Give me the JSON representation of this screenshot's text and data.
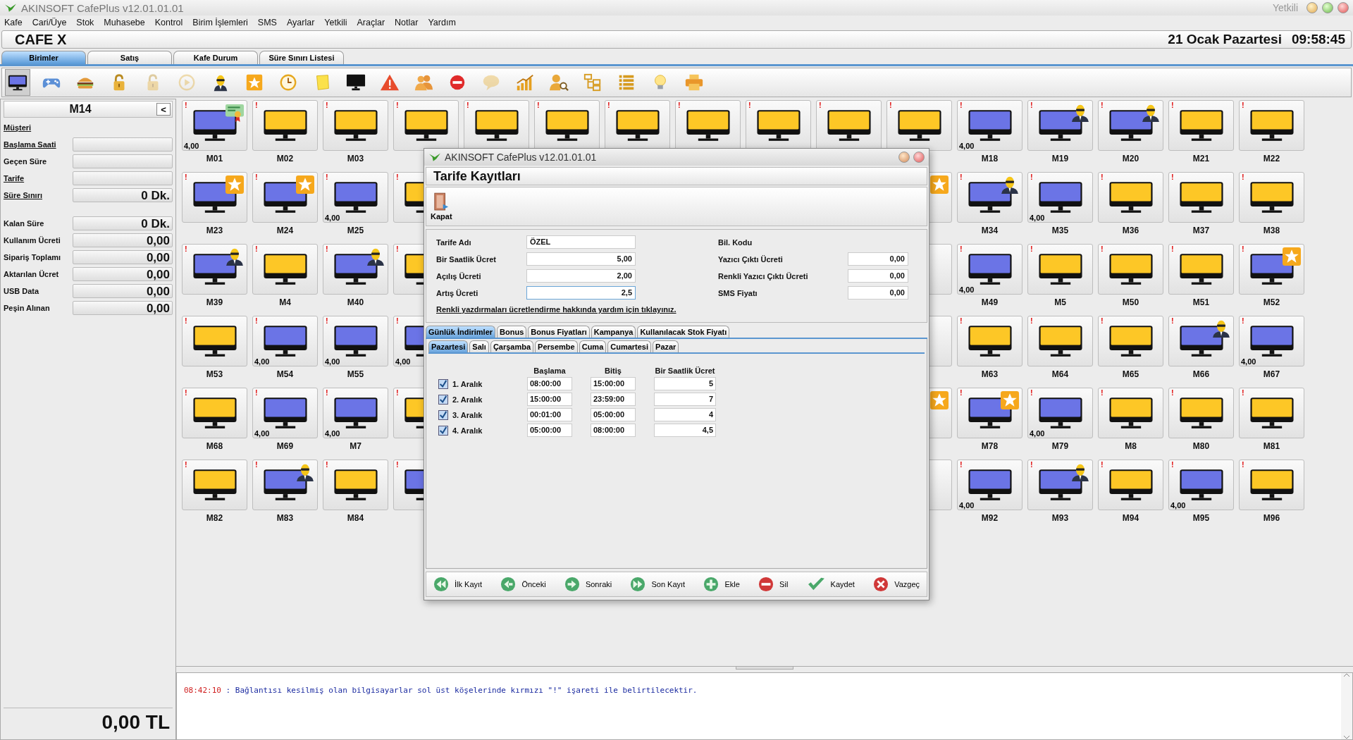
{
  "window": {
    "title": "AKINSOFT CafePlus v12.01.01.01",
    "user": "Yetkili"
  },
  "menu": [
    "Kafe",
    "Cari/Üye",
    "Stok",
    "Muhasebe",
    "Kontrol",
    "Birim İşlemleri",
    "SMS",
    "Ayarlar",
    "Yetkili",
    "Araçlar",
    "Notlar",
    "Yardım"
  ],
  "header": {
    "cafe_name": "CAFE X",
    "date": "21 Ocak Pazartesi",
    "time": "09:58:45"
  },
  "tabs": [
    {
      "label": "Birimler",
      "selected": true
    },
    {
      "label": "Satış",
      "selected": false
    },
    {
      "label": "Kafe Durum",
      "selected": false
    },
    {
      "label": "Süre Sınırı Listesi",
      "selected": false
    }
  ],
  "toolbar": [
    {
      "kind": "monitor",
      "selected": true,
      "disabled": false
    },
    {
      "kind": "gamepad",
      "selected": false,
      "disabled": false
    },
    {
      "kind": "burger",
      "selected": false,
      "disabled": false
    },
    {
      "kind": "padlock",
      "selected": false,
      "disabled": false
    },
    {
      "kind": "padlock",
      "selected": false,
      "disabled": true
    },
    {
      "kind": "play",
      "selected": false,
      "disabled": true
    },
    {
      "kind": "agent",
      "selected": false,
      "disabled": false
    },
    {
      "kind": "star",
      "selected": false,
      "disabled": false
    },
    {
      "kind": "clock",
      "selected": false,
      "disabled": false
    },
    {
      "kind": "note",
      "selected": false,
      "disabled": false
    },
    {
      "kind": "screen",
      "selected": false,
      "disabled": false
    },
    {
      "kind": "warning",
      "selected": false,
      "disabled": false
    },
    {
      "kind": "users",
      "selected": false,
      "disabled": false
    },
    {
      "kind": "stop",
      "selected": false,
      "disabled": false
    },
    {
      "kind": "chat",
      "selected": false,
      "disabled": true
    },
    {
      "kind": "chart",
      "selected": false,
      "disabled": false
    },
    {
      "kind": "usersearch",
      "selected": false,
      "disabled": false
    },
    {
      "kind": "hierarchy",
      "selected": false,
      "disabled": false
    },
    {
      "kind": "list",
      "selected": false,
      "disabled": false
    },
    {
      "kind": "bulb",
      "selected": false,
      "disabled": false
    },
    {
      "kind": "printer",
      "selected": false,
      "disabled": false
    }
  ],
  "side_panel": {
    "unit": "M14",
    "collapse_button": "<",
    "fields": [
      {
        "label": "Müşteri",
        "link": true,
        "kind": "label"
      },
      {
        "label": "Başlama Saati",
        "link": true,
        "kind": "field"
      },
      {
        "label": "Geçen Süre",
        "link": false,
        "kind": "field"
      },
      {
        "label": "Tarife",
        "link": true,
        "kind": "field"
      },
      {
        "label": "Süre Sınırı",
        "link": true,
        "kind": "field",
        "value": "0 Dk."
      },
      {
        "label": "Kalan Süre",
        "link": false,
        "kind": "field",
        "value": "0 Dk."
      },
      {
        "label": "Kullanım Ücreti",
        "link": false,
        "kind": "field",
        "value": "0,00"
      },
      {
        "label": "Sipariş Toplamı",
        "link": false,
        "kind": "field",
        "value": "0,00"
      },
      {
        "label": "Aktarılan Ücret",
        "link": false,
        "kind": "field",
        "value": "0,00"
      },
      {
        "label": "USB Data",
        "link": false,
        "kind": "field",
        "value": "0,00"
      },
      {
        "label": "Peşin Alınan",
        "link": false,
        "kind": "field",
        "value": "0,00"
      }
    ],
    "total": "0,00 TL"
  },
  "units": [
    {
      "kind": "certificate",
      "label": "M01",
      "color": "#6b74e6",
      "flag": "!",
      "amount": "4,00"
    },
    {
      "kind": "plain",
      "label": "M02",
      "color": "#fdc726",
      "flag": "!"
    },
    {
      "kind": "plain",
      "label": "M03",
      "color": "#fdc726",
      "flag": "!"
    },
    {
      "kind": "plain",
      "color": "#fdc726",
      "flag": "!"
    },
    {
      "kind": "plain",
      "color": "#fdc726",
      "flag": "!"
    },
    {
      "kind": "plain",
      "color": "#fdc726",
      "flag": "!"
    },
    {
      "kind": "plain",
      "color": "#fdc726",
      "flag": "!"
    },
    {
      "kind": "plain",
      "color": "#fdc726",
      "flag": "!"
    },
    {
      "kind": "plain",
      "color": "#fdc726",
      "flag": "!"
    },
    {
      "kind": "plain",
      "color": "#fdc726",
      "flag": "!"
    },
    {
      "kind": "plain",
      "color": "#fdc726",
      "flag": "!"
    },
    {
      "kind": "plain",
      "label": "M18",
      "color": "#6b74e6",
      "flag": "!",
      "amount": "4,00"
    },
    {
      "kind": "agent",
      "label": "M19",
      "color": "#6b74e6",
      "flag": "!"
    },
    {
      "kind": "agent",
      "label": "M20",
      "color": "#6b74e6",
      "flag": "!"
    },
    {
      "kind": "plain",
      "label": "M21",
      "color": "#fdc726",
      "flag": "!"
    },
    {
      "kind": "plain",
      "label": "M22",
      "color": "#fdc726",
      "flag": "!"
    },
    {
      "kind": "star",
      "label": "M23",
      "color": "#6b74e6",
      "flag": "!"
    },
    {
      "kind": "star",
      "label": "M24",
      "color": "#6b74e6",
      "flag": "!"
    },
    {
      "kind": "plain",
      "label": "M25",
      "color": "#6b74e6",
      "flag": "!",
      "amount": "4,00"
    },
    {
      "kind": "cut",
      "color": "#fdc726",
      "flag": "!"
    },
    {
      "kind": "covered"
    },
    {
      "kind": "covered"
    },
    {
      "kind": "covered"
    },
    {
      "kind": "covered"
    },
    {
      "kind": "covered"
    },
    {
      "kind": "covered"
    },
    {
      "kind": "star"
    },
    {
      "kind": "agent",
      "label": "M34",
      "color": "#6b74e6",
      "flag": "!"
    },
    {
      "kind": "plain",
      "label": "M35",
      "color": "#6b74e6",
      "flag": "!",
      "amount": "4,00"
    },
    {
      "kind": "plain",
      "label": "M36",
      "color": "#fdc726",
      "flag": "!"
    },
    {
      "kind": "plain",
      "label": "M37",
      "color": "#fdc726",
      "flag": "!"
    },
    {
      "kind": "plain",
      "label": "M38",
      "color": "#fdc726",
      "flag": "!"
    },
    {
      "kind": "agent",
      "label": "M39",
      "color": "#6b74e6",
      "flag": "!"
    },
    {
      "kind": "plain",
      "label": "M4",
      "color": "#fdc726",
      "flag": "!"
    },
    {
      "kind": "agent",
      "label": "M40",
      "color": "#6b74e6",
      "flag": "!"
    },
    {
      "kind": "cut",
      "color": "#fdc726",
      "flag": "!"
    },
    {
      "kind": "covered"
    },
    {
      "kind": "covered"
    },
    {
      "kind": "covered"
    },
    {
      "kind": "covered"
    },
    {
      "kind": "covered"
    },
    {
      "kind": "covered"
    },
    {
      "kind": "plain"
    },
    {
      "kind": "plain",
      "label": "M49",
      "color": "#6b74e6",
      "flag": "!",
      "amount": "4,00"
    },
    {
      "kind": "plain",
      "label": "M5",
      "color": "#fdc726",
      "flag": "!"
    },
    {
      "kind": "plain",
      "label": "M50",
      "color": "#fdc726",
      "flag": "!"
    },
    {
      "kind": "plain",
      "label": "M51",
      "color": "#fdc726",
      "flag": "!"
    },
    {
      "kind": "star",
      "label": "M52",
      "color": "#6b74e6",
      "flag": "!"
    },
    {
      "kind": "plain",
      "label": "M53",
      "color": "#fdc726",
      "flag": "!"
    },
    {
      "kind": "plain",
      "label": "M54",
      "color": "#6b74e6",
      "flag": "!",
      "amount": "4,00"
    },
    {
      "kind": "plain",
      "label": "M55",
      "color": "#6b74e6",
      "flag": "!",
      "amount": "4,00"
    },
    {
      "kind": "cut",
      "color": "#6b74e6",
      "flag": "!",
      "amount": "4,00"
    },
    {
      "kind": "covered"
    },
    {
      "kind": "covered"
    },
    {
      "kind": "covered"
    },
    {
      "kind": "covered"
    },
    {
      "kind": "covered"
    },
    {
      "kind": "covered"
    },
    {
      "kind": "plain"
    },
    {
      "kind": "plain",
      "label": "M63",
      "color": "#fdc726",
      "flag": "!"
    },
    {
      "kind": "plain",
      "label": "M64",
      "color": "#fdc726",
      "flag": "!"
    },
    {
      "kind": "plain",
      "label": "M65",
      "color": "#fdc726",
      "flag": "!"
    },
    {
      "kind": "agent",
      "label": "M66",
      "color": "#6b74e6",
      "flag": "!"
    },
    {
      "kind": "plain",
      "label": "M67",
      "color": "#6b74e6",
      "flag": "!",
      "amount": "4,00"
    },
    {
      "kind": "plain",
      "label": "M68",
      "color": "#fdc726",
      "flag": "!"
    },
    {
      "kind": "plain",
      "label": "M69",
      "color": "#6b74e6",
      "flag": "!",
      "amount": "4,00"
    },
    {
      "kind": "plain",
      "label": "M7",
      "color": "#6b74e6",
      "flag": "!",
      "amount": "4,00"
    },
    {
      "kind": "cut",
      "color": "#fdc726",
      "flag": "!"
    },
    {
      "kind": "covered"
    },
    {
      "kind": "covered"
    },
    {
      "kind": "covered"
    },
    {
      "kind": "covered"
    },
    {
      "kind": "covered"
    },
    {
      "kind": "covered"
    },
    {
      "kind": "star"
    },
    {
      "kind": "star",
      "label": "M78",
      "color": "#6b74e6",
      "flag": "!"
    },
    {
      "kind": "plain",
      "label": "M79",
      "color": "#6b74e6",
      "flag": "!",
      "amount": "4,00"
    },
    {
      "kind": "plain",
      "label": "M8",
      "color": "#fdc726",
      "flag": "!"
    },
    {
      "kind": "plain",
      "label": "M80",
      "color": "#fdc726",
      "flag": "!"
    },
    {
      "kind": "plain",
      "label": "M81",
      "color": "#fdc726",
      "flag": "!"
    },
    {
      "kind": "plain",
      "label": "M82",
      "color": "#fdc726",
      "flag": "!"
    },
    {
      "kind": "agent",
      "label": "M83",
      "color": "#6b74e6",
      "flag": "!"
    },
    {
      "kind": "plain",
      "label": "M84",
      "color": "#fdc726",
      "flag": "!"
    },
    {
      "kind": "cut",
      "color": "#6b74e6",
      "flag": "!"
    },
    {
      "kind": "covered"
    },
    {
      "kind": "covered"
    },
    {
      "kind": "covered"
    },
    {
      "kind": "covered"
    },
    {
      "kind": "covered"
    },
    {
      "kind": "covered"
    },
    {
      "kind": "plain"
    },
    {
      "kind": "plain",
      "label": "M92",
      "color": "#6b74e6",
      "flag": "!",
      "amount": "4,00"
    },
    {
      "kind": "agent",
      "label": "M93",
      "color": "#6b74e6",
      "flag": "!"
    },
    {
      "kind": "plain",
      "label": "M94",
      "color": "#fdc726",
      "flag": "!"
    },
    {
      "kind": "plain",
      "label": "M95",
      "color": "#6b74e6",
      "flag": "!",
      "amount": "4,00"
    },
    {
      "kind": "plain",
      "label": "M96",
      "color": "#fdc726",
      "flag": "!"
    }
  ],
  "log": [
    {
      "time": "08:42:10",
      "message": ": Bağlantısı kesilmiş olan bilgisayarlar sol üst köşelerinde kırmızı \"!\" işareti ile belirtilecektir."
    }
  ],
  "dialog": {
    "title": "AKINSOFT CafePlus v12.01.01.01",
    "heading": "Tarife Kayıtları",
    "close_button": "Kapat",
    "left_fields": [
      {
        "label": "Tarife Adı",
        "value": "ÖZEL",
        "kind": "text",
        "focused": false
      },
      {
        "label": "Bir Saatlik Ücret",
        "value": "5,00",
        "kind": "number",
        "focused": false
      },
      {
        "label": "Açılış Ücreti",
        "value": "2,00",
        "kind": "number",
        "focused": false
      },
      {
        "label": "Artış Ücreti",
        "value": "2,5",
        "kind": "number",
        "focused": true
      }
    ],
    "right_fields": [
      {
        "label": "Bil. Kodu",
        "kind": "label"
      },
      {
        "label": "Yazıcı Çıktı Ücreti",
        "value": "0,00",
        "kind": "field"
      },
      {
        "label": "Renkli Yazıcı Çıktı Ücreti",
        "value": "0,00",
        "kind": "field"
      },
      {
        "label": "SMS Fiyatı",
        "value": "0,00",
        "kind": "field"
      }
    ],
    "help_link": "Renkli yazdırmaları ücretlendirme hakkında yardım için tıklayınız.",
    "tabs": [
      {
        "label": "Günlük İndirimler",
        "selected": true
      },
      {
        "label": "Bonus",
        "selected": false
      },
      {
        "label": "Bonus Fiyatları",
        "selected": false
      },
      {
        "label": "Kampanya",
        "selected": false
      },
      {
        "label": "Kullanılacak Stok Fiyatı",
        "selected": false
      }
    ],
    "day_tabs": [
      {
        "label": "Pazartesi",
        "selected": true
      },
      {
        "label": "Salı",
        "selected": false
      },
      {
        "label": "Çarşamba",
        "selected": false
      },
      {
        "label": "Persembe",
        "selected": false
      },
      {
        "label": "Cuma",
        "selected": false
      },
      {
        "label": "Cumartesi",
        "selected": false
      },
      {
        "label": "Pazar",
        "selected": false
      }
    ],
    "columns": [
      "Başlama",
      "Bitiş",
      "Bir Saatlik Ücret"
    ],
    "ranges": [
      {
        "label": "1. Aralık",
        "checked": true,
        "start": "08:00:00",
        "end": "15:00:00",
        "rate": "5"
      },
      {
        "label": "2. Aralık",
        "checked": true,
        "start": "15:00:00",
        "end": "23:59:00",
        "rate": "7"
      },
      {
        "label": "3. Aralık",
        "checked": true,
        "start": "00:01:00",
        "end": "05:00:00",
        "rate": "4"
      },
      {
        "label": "4. Aralık",
        "checked": true,
        "start": "05:00:00",
        "end": "08:00:00",
        "rate": "4,5"
      }
    ],
    "nav_buttons": [
      {
        "label": "İlk Kayıt",
        "kind": "first"
      },
      {
        "label": "Önceki",
        "kind": "prev"
      },
      {
        "label": "Sonraki",
        "kind": "next"
      },
      {
        "label": "Son Kayıt",
        "kind": "last"
      },
      {
        "label": "Ekle",
        "kind": "add"
      },
      {
        "label": "Sil",
        "kind": "delete"
      },
      {
        "label": "Kaydet",
        "kind": "save"
      },
      {
        "label": "Vazgeç",
        "kind": "cancel"
      }
    ]
  }
}
